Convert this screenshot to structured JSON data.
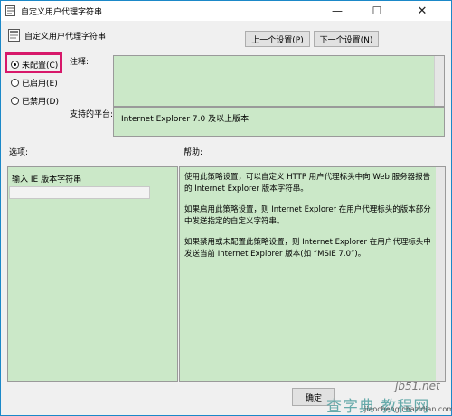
{
  "window": {
    "title": "自定义用户代理字符串",
    "controls": {
      "minimize": "—",
      "maximize": "☐",
      "close": "✕"
    }
  },
  "header": {
    "setting_name": "自定义用户代理字符串",
    "prev_button": "上一个设置(P)",
    "next_button": "下一个设置(N)"
  },
  "state": {
    "options": [
      {
        "label": "未配置(C)",
        "selected": true
      },
      {
        "label": "已启用(E)",
        "selected": false
      },
      {
        "label": "已禁用(D)",
        "selected": false
      }
    ]
  },
  "comment": {
    "label": "注释:",
    "value": ""
  },
  "platform": {
    "label": "支持的平台:",
    "value": "Internet Explorer 7.0 及以上版本"
  },
  "options_section": {
    "label": "选项:",
    "field_label": "输入 IE 版本字符串",
    "field_value": ""
  },
  "help_section": {
    "label": "帮助:",
    "paragraphs": [
      "使用此策略设置，可以自定义 HTTP 用户代理标头中向 Web 服务器报告的 Internet Explorer 版本字符串。",
      "如果启用此策略设置，则 Internet Explorer 在用户代理标头的版本部分中发送指定的自定义字符串。",
      "如果禁用或未配置此策略设置，则 Internet Explorer 在用户代理标头中发送当前 Internet Explorer 版本(如 “MSIE 7.0”)。"
    ]
  },
  "footer": {
    "ok_button": "确定"
  },
  "watermark": {
    "site": "jb51.net",
    "brand": "查字典 教程网",
    "url": "jiaocheng.chazidian.com"
  },
  "colors": {
    "highlight_border": "#d7186a",
    "pane_background": "#cbe8c8",
    "window_border": "#1b88c8"
  }
}
